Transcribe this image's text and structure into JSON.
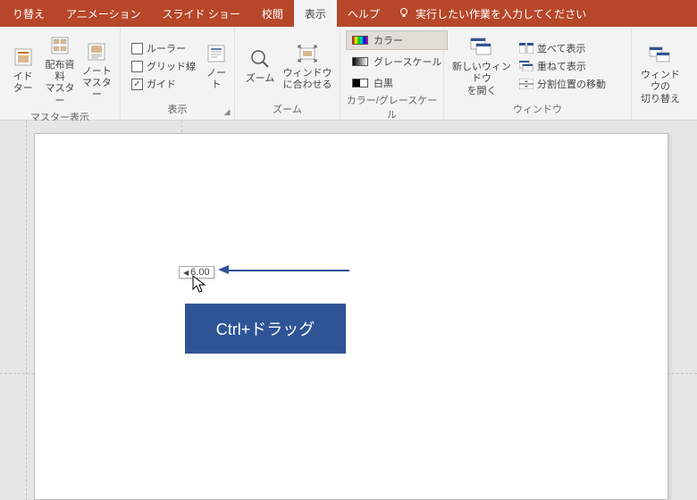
{
  "tabs": {
    "t0": "り替え",
    "t1": "アニメーション",
    "t2": "スライド ショー",
    "t3": "校閲",
    "t4": "表示",
    "t5": "ヘルプ"
  },
  "tellme": "実行したい作業を入力してください",
  "ribbon": {
    "master": {
      "label": "マスター表示",
      "slide": "イド\nター",
      "handout": "配布資料\nマスター",
      "notes": "ノート\nマスター"
    },
    "show": {
      "label": "表示",
      "ruler": "ルーラー",
      "grid": "グリッド線",
      "guides": "ガイド",
      "notes": "ノー\nト"
    },
    "zoom": {
      "label": "ズーム",
      "zoom": "ズーム",
      "fit": "ウィンドウ\nに合わせる"
    },
    "color": {
      "label": "カラー/グレースケール",
      "color": "カラー",
      "gray": "グレースケール",
      "bw": "白黒"
    },
    "window": {
      "label": "ウィンドウ",
      "newwin": "新しいウィンドウ\nを開く",
      "arrange": "並べて表示",
      "cascade": "重ねて表示",
      "split": "分割位置の移動",
      "switch": "ウィンドウの\n切り替え"
    }
  },
  "measurement": "6.00",
  "bluebox": "Ctrl+ドラッグ"
}
